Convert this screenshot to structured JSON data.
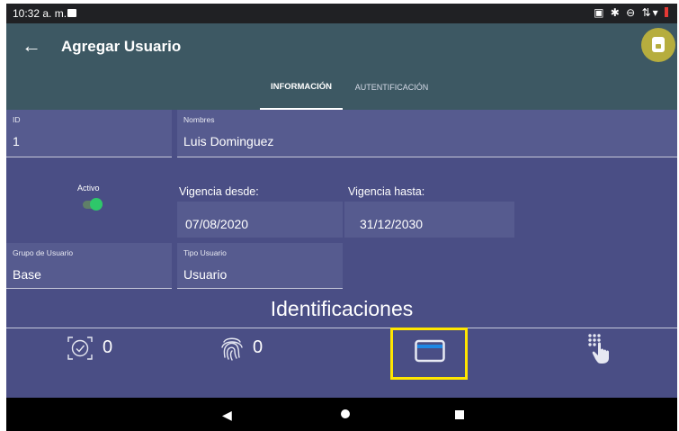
{
  "status_bar": {
    "time": "10:32 a. m.",
    "icons": "▣ ✱ ⊖ ⇅▾"
  },
  "app_bar": {
    "title": "Agregar Usuario",
    "back_icon": "arrow-left-icon",
    "save_icon": "save-disk-icon"
  },
  "tabs": [
    {
      "label": "INFORMACIÓN",
      "active": true
    },
    {
      "label": "AUTENTIFICACIÓN",
      "active": false
    }
  ],
  "form": {
    "id": {
      "label": "ID",
      "value": "1"
    },
    "nombres": {
      "label": "Nombres",
      "value": "Luis Dominguez"
    },
    "activo": {
      "label": "Activo",
      "on": true
    },
    "vigencia_desde": {
      "label": "Vigencia desde:",
      "value": "07/08/2020"
    },
    "vigencia_hasta": {
      "label": "Vigencia hasta:",
      "value": "31/12/2030"
    },
    "grupo": {
      "label": "Grupo de Usuario",
      "value": "Base"
    },
    "tipo": {
      "label": "Tipo Usuario",
      "value": "Usuario"
    }
  },
  "identificaciones": {
    "title": "Identificaciones",
    "items": [
      {
        "icon": "face-id-icon",
        "count": "0"
      },
      {
        "icon": "fingerprint-icon",
        "count": "0"
      },
      {
        "icon": "card-icon",
        "selected": true
      },
      {
        "icon": "keypad-touch-icon"
      }
    ]
  },
  "colors": {
    "background": "#4a4e85",
    "app_bar": "#3d5863",
    "fab": "#b6ad3e",
    "toggle_on": "#2ec76a",
    "highlight": "#ffe600",
    "card_stripe": "#1e88e5"
  }
}
